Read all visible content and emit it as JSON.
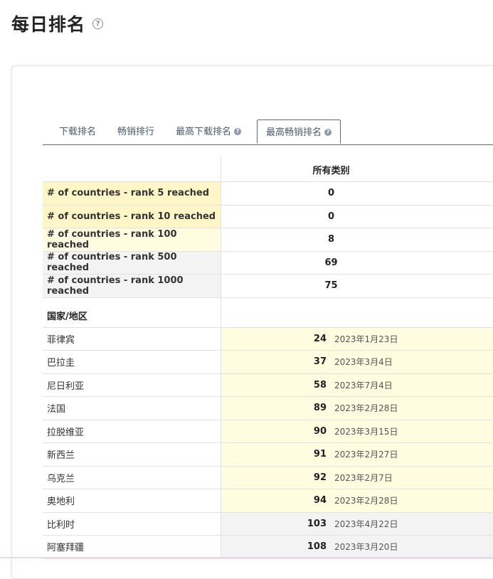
{
  "page": {
    "title": "每日排名",
    "help_icon": "?"
  },
  "tabs": [
    {
      "label": "下载排名",
      "has_help": false,
      "active": false
    },
    {
      "label": "畅销排行",
      "has_help": false,
      "active": false
    },
    {
      "label": "最高下载排名",
      "has_help": true,
      "active": false
    },
    {
      "label": "最高畅销排名",
      "has_help": true,
      "active": true
    }
  ],
  "table": {
    "column_header": "所有类别",
    "stats": [
      {
        "label": "# of countries - rank 5 reached",
        "value": "0"
      },
      {
        "label": "# of countries - rank 10 reached",
        "value": "0"
      },
      {
        "label": "# of countries - rank 100 reached",
        "value": "8"
      },
      {
        "label": "# of countries - rank 500 reached",
        "value": "69"
      },
      {
        "label": "# of countries - rank 1000 reached",
        "value": "75"
      }
    ],
    "section_label": "国家/地区",
    "countries": [
      {
        "name": "菲律宾",
        "rank": "24",
        "date": "2023年1月23日"
      },
      {
        "name": "巴拉圭",
        "rank": "37",
        "date": "2023年3月4日"
      },
      {
        "name": "尼日利亚",
        "rank": "58",
        "date": "2023年7月4日"
      },
      {
        "name": "法国",
        "rank": "89",
        "date": "2023年2月28日"
      },
      {
        "name": "拉脱维亚",
        "rank": "90",
        "date": "2023年3月15日"
      },
      {
        "name": "新西兰",
        "rank": "91",
        "date": "2023年2月27日"
      },
      {
        "name": "乌克兰",
        "rank": "92",
        "date": "2023年2月7日"
      },
      {
        "name": "奥地利",
        "rank": "94",
        "date": "2023年2月28日"
      },
      {
        "name": "比利时",
        "rank": "103",
        "date": "2023年4月22日"
      },
      {
        "name": "阿塞拜疆",
        "rank": "108",
        "date": "2023年3月20日"
      }
    ]
  },
  "colors": {
    "highlight_strong": "#fff6c8",
    "highlight_light": "#fffce0",
    "neutral_row": "#f3f3f3",
    "tab_border": "#5a6b7a"
  }
}
